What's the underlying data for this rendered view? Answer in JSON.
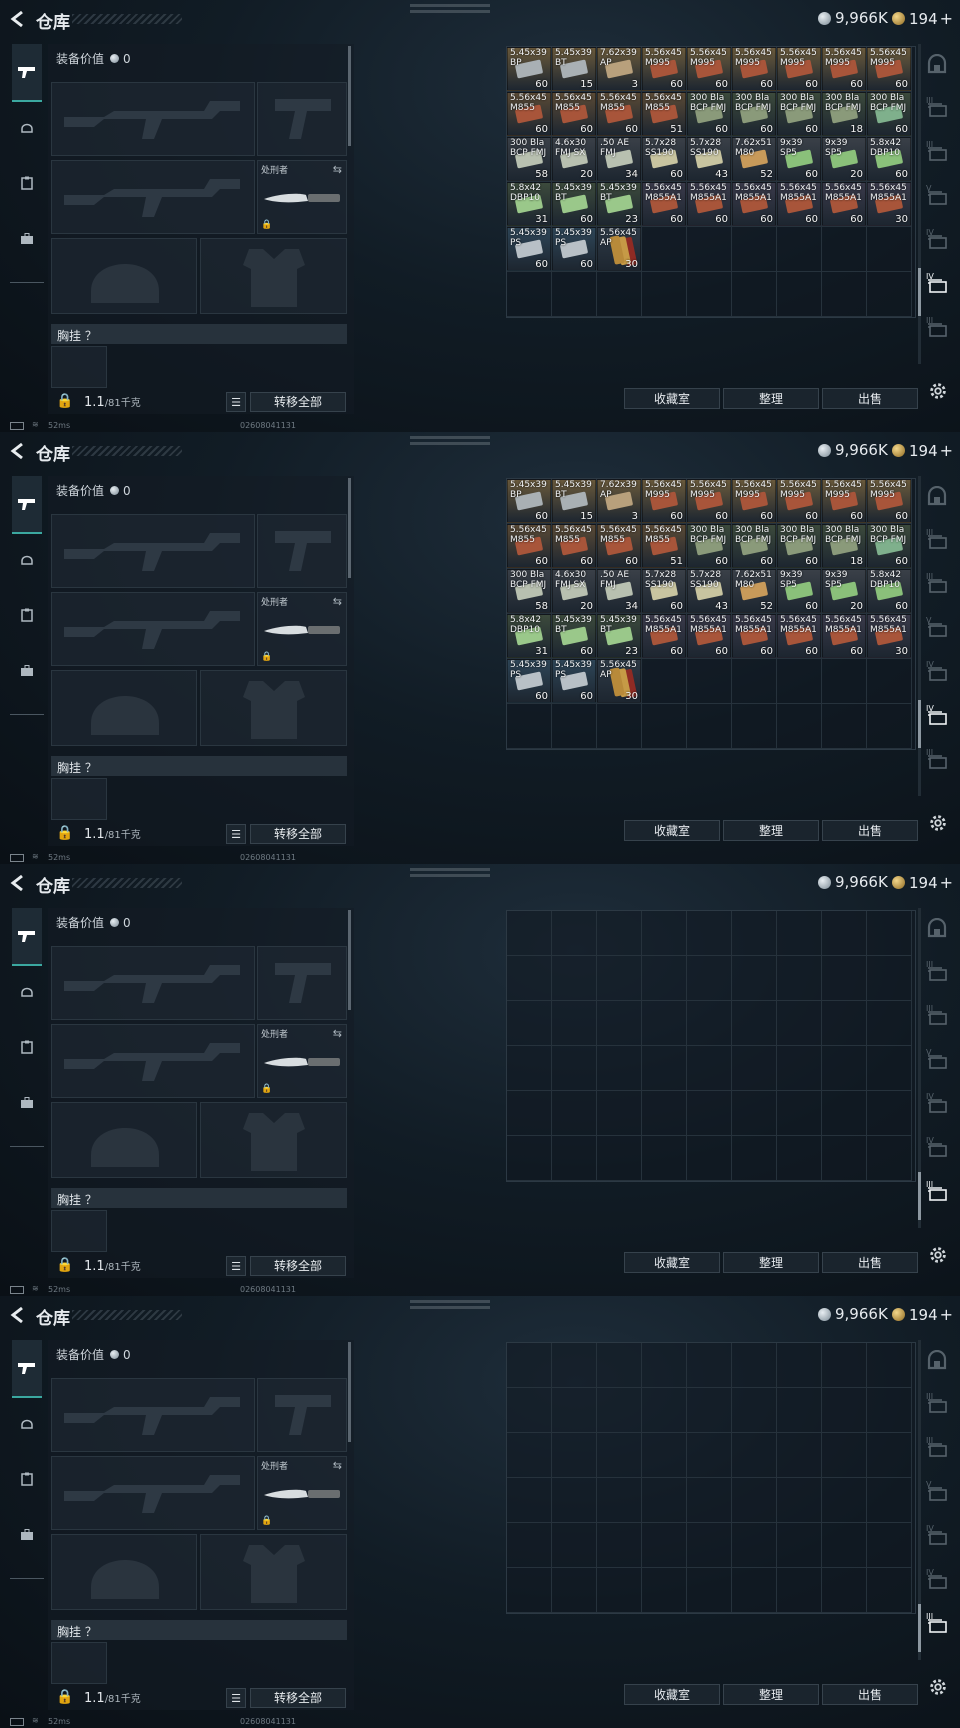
{
  "header": {
    "title": "仓库",
    "silver": "9,966K",
    "gold": "194",
    "gold_plus": "+"
  },
  "equipment": {
    "value_label": "装备价值",
    "value": "0",
    "knife_label": "处刑者",
    "chest_label": "胸挂 ？",
    "weight": "1.1",
    "weight_max": "/81千克",
    "transfer_all": "转移全部"
  },
  "status": {
    "ping": "52ms",
    "uid": "02608041131"
  },
  "actions": {
    "collection": "收藏室",
    "sort": "整理",
    "sell": "出售"
  },
  "rail": {
    "labels": [
      "",
      "III",
      "III",
      "V",
      "IV",
      "IV",
      "III"
    ]
  },
  "icons": {
    "back": "chevron-left-icon",
    "pistol": "pistol-icon",
    "helmet": "helmet-icon",
    "clipboard": "clipboard-icon",
    "briefcase": "briefcase-icon",
    "gear": "gear-icon",
    "lock": "lock-icon",
    "list": "list-icon",
    "swap": "swap-icon"
  },
  "items": [
    {
      "name": "5.45x39\nBP",
      "count": "60",
      "color": "#6a5a3c",
      "box": "#a9b0b4"
    },
    {
      "name": "5.45x39\nBT",
      "count": "15",
      "color": "#6a5a3c",
      "box": "#a9b0b4"
    },
    {
      "name": "7.62x39\nAP",
      "count": "3",
      "color": "#6a5a3c",
      "box": "#b8a07c"
    },
    {
      "name": "5.56x45\nM995",
      "count": "60",
      "color": "#6a5a3c",
      "box": "#a8553a"
    },
    {
      "name": "5.56x45\nM995",
      "count": "60",
      "color": "#6a5a3c",
      "box": "#a8553a"
    },
    {
      "name": "5.56x45\nM995",
      "count": "60",
      "color": "#6a5a3c",
      "box": "#a8553a"
    },
    {
      "name": "5.56x45\nM995",
      "count": "60",
      "color": "#6a5a3c",
      "box": "#a8553a"
    },
    {
      "name": "5.56x45\nM995",
      "count": "60",
      "color": "#6a5a3c",
      "box": "#a8553a"
    },
    {
      "name": "5.56x45\nM995",
      "count": "60",
      "color": "#6a5a3c",
      "box": "#a8553a"
    },
    {
      "name": "5.56x45\nM855",
      "count": "60",
      "color": "#5a4a36",
      "box": "#a8553a"
    },
    {
      "name": "5.56x45\nM855",
      "count": "60",
      "color": "#5a4a36",
      "box": "#a8553a"
    },
    {
      "name": "5.56x45\nM855",
      "count": "60",
      "color": "#5a4a36",
      "box": "#a8553a"
    },
    {
      "name": "5.56x45\nM855",
      "count": "51",
      "color": "#5a4a36",
      "box": "#a8553a"
    },
    {
      "name": "300 Bla\nBCP FMJ",
      "count": "60",
      "color": "#3c4a3c",
      "box": "#8a9a7a"
    },
    {
      "name": "300 Bla\nBCP FMJ",
      "count": "60",
      "color": "#3c4a3c",
      "box": "#8a9a7a"
    },
    {
      "name": "300 Bla\nBCP FMJ",
      "count": "60",
      "color": "#3c4a3c",
      "box": "#8a9a7a"
    },
    {
      "name": "300 Bla\nBCP FMJ",
      "count": "18",
      "color": "#3c4a3c",
      "box": "#8a9a7a"
    },
    {
      "name": "300 Bla\nBCP FMJ",
      "count": "60",
      "color": "#3c4a3c",
      "box": "#7fb08c"
    },
    {
      "name": "300 Bla\nBCP FMJ",
      "count": "58",
      "color": "#3a4048",
      "box": "#b8c0b0"
    },
    {
      "name": "4.6x30\nFMJ SX",
      "count": "20",
      "color": "#3a4048",
      "box": "#b8c0b0"
    },
    {
      "name": ".50 AE\nFMJ",
      "count": "34",
      "color": "#3a4048",
      "box": "#b8c0b0"
    },
    {
      "name": "5.7x28\nSS190",
      "count": "60",
      "color": "#3a4048",
      "box": "#c8c4a0"
    },
    {
      "name": "5.7x28\nSS190",
      "count": "43",
      "color": "#3a4048",
      "box": "#c8c4a0"
    },
    {
      "name": "7.62x51\nM80",
      "count": "52",
      "color": "#3a4048",
      "box": "#c89a5a"
    },
    {
      "name": "9x39\nSP5",
      "count": "60",
      "color": "#3a4048",
      "box": "#8ac07a"
    },
    {
      "name": "9x39\nSP5",
      "count": "20",
      "color": "#3a4048",
      "box": "#8ac07a"
    },
    {
      "name": "5.8x42\nDBP10",
      "count": "60",
      "color": "#3a4048",
      "box": "#8ac07a"
    },
    {
      "name": "5.8x42\nDBP10",
      "count": "31",
      "color": "#3c4a3c",
      "box": "#9ac88a"
    },
    {
      "name": "5.45x39\nBT",
      "count": "60",
      "color": "#3c4a3c",
      "box": "#9ac88a"
    },
    {
      "name": "5.45x39\nBT",
      "count": "23",
      "color": "#3c4a3c",
      "box": "#9ac88a"
    },
    {
      "name": "5.56x45\nM855A1",
      "count": "60",
      "color": "#3a3a4a",
      "box": "#a8553a"
    },
    {
      "name": "5.56x45\nM855A1",
      "count": "60",
      "color": "#3a3a4a",
      "box": "#a8553a"
    },
    {
      "name": "5.56x45\nM855A1",
      "count": "60",
      "color": "#3a3a4a",
      "box": "#a8553a"
    },
    {
      "name": "5.56x45\nM855A1",
      "count": "60",
      "color": "#3a3a4a",
      "box": "#a8553a"
    },
    {
      "name": "5.56x45\nM855A1",
      "count": "60",
      "color": "#3a3a4a",
      "box": "#a8553a"
    },
    {
      "name": "5.56x45\nM855A1",
      "count": "30",
      "color": "#3a3a4a",
      "box": "#a8553a"
    },
    {
      "name": "5.45x39\nPS",
      "count": "60",
      "color": "#2e4658",
      "box": "#b8c0c6"
    },
    {
      "name": "5.45x39\nPS",
      "count": "60",
      "color": "#2e4658",
      "box": "#b8c0c6"
    },
    {
      "name": "5.56x45\nAP",
      "count": "30",
      "color": "#2e3a46",
      "box": "ammo"
    }
  ]
}
